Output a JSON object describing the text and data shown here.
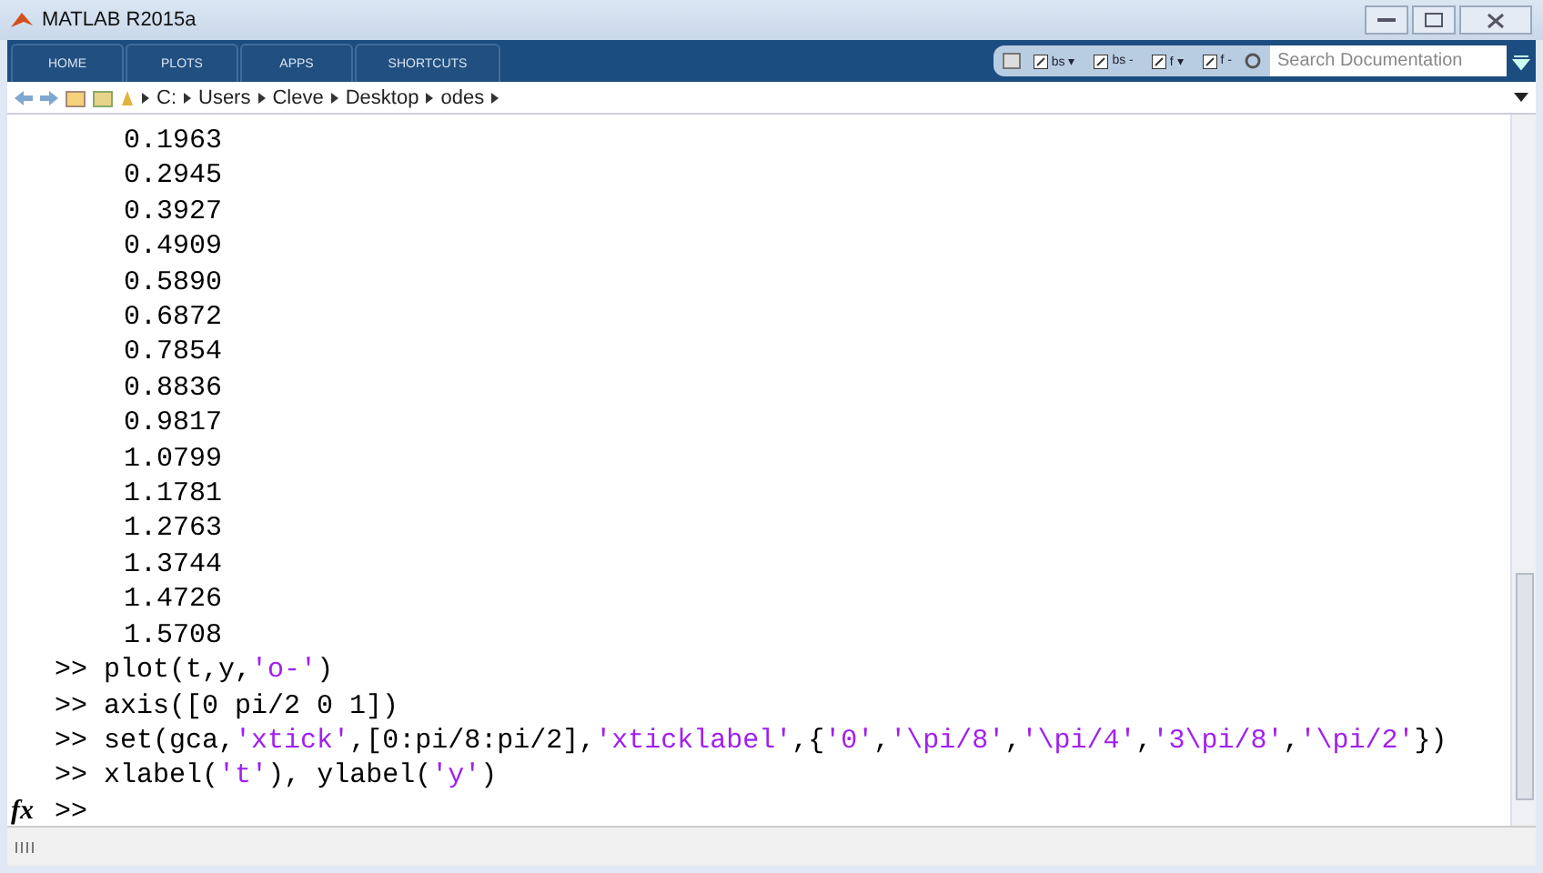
{
  "window": {
    "title": "MATLAB R2015a"
  },
  "tabs": [
    {
      "label": "HOME",
      "selected": false
    },
    {
      "label": "PLOTS",
      "selected": false
    },
    {
      "label": "APPS",
      "selected": false
    },
    {
      "label": "SHORTCUTS",
      "selected": false
    }
  ],
  "shortcuts": [
    "bs ▾",
    "bs -",
    "f ▾",
    "f -"
  ],
  "search": {
    "placeholder": "Search Documentation"
  },
  "path": [
    "C:",
    "Users",
    "Cleve",
    "Desktop",
    "odes"
  ],
  "output": [
    "0.1963",
    "0.2945",
    "0.3927",
    "0.4909",
    "0.5890",
    "0.6872",
    "0.7854",
    "0.8836",
    "0.9817",
    "1.0799",
    "1.1781",
    "1.2763",
    "1.3744",
    "1.4726",
    "1.5708"
  ],
  "commands": [
    {
      "prompt": ">>",
      "parts": [
        {
          "kind": "code",
          "text": "plot(t,y,"
        },
        {
          "kind": "string",
          "text": "'o-'"
        },
        {
          "kind": "code",
          "text": ")"
        }
      ]
    },
    {
      "prompt": ">>",
      "parts": [
        {
          "kind": "code",
          "text": "axis([0 pi/2 0 1])"
        }
      ]
    },
    {
      "prompt": ">>",
      "parts": [
        {
          "kind": "code",
          "text": "set(gca,"
        },
        {
          "kind": "string",
          "text": "'xtick'"
        },
        {
          "kind": "code",
          "text": ",[0:pi/8:pi/2],"
        },
        {
          "kind": "string",
          "text": "'xticklabel'"
        },
        {
          "kind": "code",
          "text": ",{"
        },
        {
          "kind": "string",
          "text": "'0'"
        },
        {
          "kind": "code",
          "text": ","
        },
        {
          "kind": "string",
          "text": "'\\pi/8'"
        },
        {
          "kind": "code",
          "text": ","
        },
        {
          "kind": "string",
          "text": "'\\pi/4'"
        },
        {
          "kind": "code",
          "text": ","
        },
        {
          "kind": "string",
          "text": "'3\\pi/8'"
        },
        {
          "kind": "code",
          "text": ","
        },
        {
          "kind": "string",
          "text": "'\\pi/2'"
        },
        {
          "kind": "code",
          "text": "})"
        }
      ]
    },
    {
      "prompt": ">>",
      "parts": [
        {
          "kind": "code",
          "text": "xlabel("
        },
        {
          "kind": "string",
          "text": "'t'"
        },
        {
          "kind": "code",
          "text": "), ylabel("
        },
        {
          "kind": "string",
          "text": "'y'"
        },
        {
          "kind": "code",
          "text": ")"
        }
      ]
    }
  ],
  "input": {
    "function_button": "fx",
    "prompt": ">>"
  }
}
